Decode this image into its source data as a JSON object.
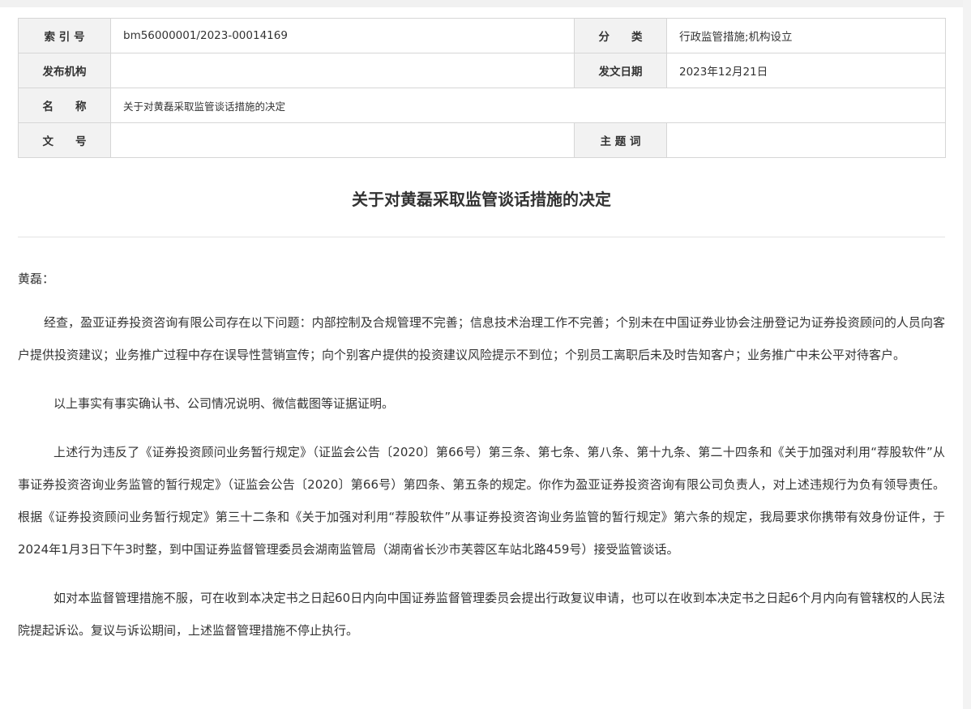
{
  "meta": {
    "index_label": "索 引 号",
    "index_value": "bm56000001/2023-00014169",
    "category_label": "分　　类",
    "category_value": "行政监管措施;机构设立",
    "issuer_label": "发布机构",
    "issuer_value": "",
    "date_label": "发文日期",
    "date_value": "2023年12月21日",
    "name_label": "名　　称",
    "name_value": "关于对黄磊采取监管谈话措施的决定",
    "doc_no_label": "文　　号",
    "doc_no_value": "",
    "keywords_label": "主 题 词",
    "keywords_value": ""
  },
  "document": {
    "title": "关于对黄磊采取监管谈话措施的决定",
    "salutation": "黄磊：",
    "paragraphs": [
      "经查，盈亚证券投资咨询有限公司存在以下问题：内部控制及合规管理不完善；信息技术治理工作不完善；个别未在中国证券业协会注册登记为证券投资顾问的人员向客户提供投资建议；业务推广过程中存在误导性营销宣传；向个别客户提供的投资建议风险提示不到位；个别员工离职后未及时告知客户；业务推广中未公平对待客户。",
      "以上事实有事实确认书、公司情况说明、微信截图等证据证明。",
      "上述行为违反了《证券投资顾问业务暂行规定》（证监会公告〔2020〕第66号）第三条、第七条、第八条、第十九条、第二十四条和《关于加强对利用“荐股软件”从事证券投资咨询业务监管的暂行规定》（证监会公告〔2020〕第66号）第四条、第五条的规定。你作为盈亚证券投资咨询有限公司负责人，对上述违规行为负有领导责任。根据《证券投资顾问业务暂行规定》第三十二条和《关于加强对利用“荐股软件”从事证券投资咨询业务监管的暂行规定》第六条的规定，我局要求你携带有效身份证件，于2024年1月3日下午3时整，到中国证券监督管理委员会湖南监管局（湖南省长沙市芙蓉区车站北路459号）接受监管谈话。",
      "如对本监督管理措施不服，可在收到本决定书之日起60日内向中国证券监督管理委员会提出行政复议申请，也可以在收到本决定书之日起6个月内向有管辖权的人民法院提起诉讼。复议与诉讼期间，上述监督管理措施不停止执行。"
    ]
  }
}
